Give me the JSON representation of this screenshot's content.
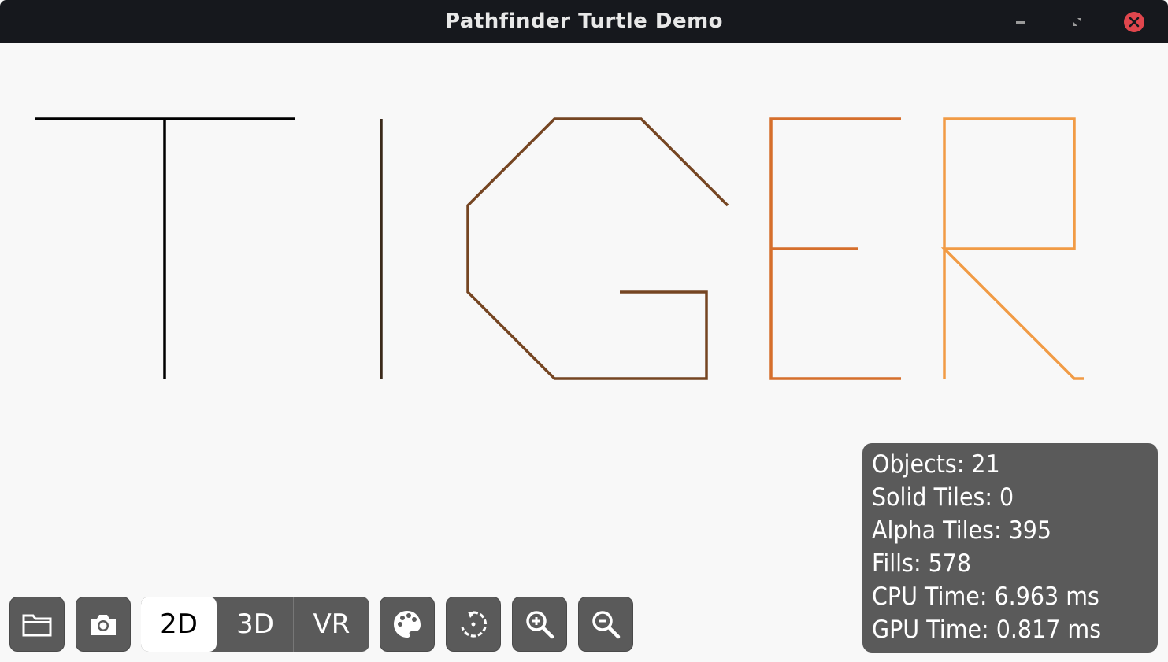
{
  "window": {
    "title": "Pathfinder Turtle Demo"
  },
  "canvas": {
    "text": "TIGER",
    "letter_colors": [
      "#000000",
      "#3b2a1a",
      "#754522",
      "#d66f2c",
      "#f19b45"
    ]
  },
  "toolbar": {
    "open_icon": "folder-icon",
    "screenshot_icon": "camera-icon",
    "modes": [
      "2D",
      "3D",
      "VR"
    ],
    "active_mode": "2D",
    "palette_icon": "palette-icon",
    "rotate_icon": "rotate-icon",
    "zoom_in_icon": "zoom-in-icon",
    "zoom_out_icon": "zoom-out-icon"
  },
  "stats": {
    "objects": "Objects: 21",
    "solid_tiles": "Solid Tiles: 0",
    "alpha_tiles": "Alpha Tiles: 395",
    "fills": "Fills: 578",
    "cpu_time": "CPU Time: 6.963 ms",
    "gpu_time": "GPU Time: 0.817 ms"
  },
  "colors": {
    "titlebar": "#16181d",
    "panel": "#5a5a5a",
    "close_button": "#e0464d"
  }
}
